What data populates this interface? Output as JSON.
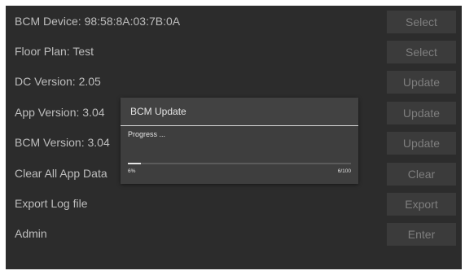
{
  "settings": {
    "rows": [
      {
        "label": "BCM Device: 98:58:8A:03:7B:0A",
        "button": "Select"
      },
      {
        "label": "Floor Plan:  Test",
        "button": "Select"
      },
      {
        "label": "DC Version:  2.05",
        "button": "Update"
      },
      {
        "label": "App Version:  3.04",
        "button": "Update"
      },
      {
        "label": "BCM Version:  3.04",
        "button": "Update"
      },
      {
        "label": "Clear All App Data",
        "button": "Clear"
      },
      {
        "label": "Export Log file",
        "button": "Export"
      },
      {
        "label": "Admin",
        "button": "Enter"
      }
    ]
  },
  "dialog": {
    "title": "BCM Update",
    "message": "Progress ...",
    "percent_label": "6%",
    "count_label": "6/100",
    "progress": 0.06
  },
  "colors": {
    "background": "#2c2c2c",
    "text": "#bdbdbd",
    "button_bg": "#3b3b3b",
    "button_text": "#7e7e7e",
    "dialog_bg": "#424242"
  }
}
